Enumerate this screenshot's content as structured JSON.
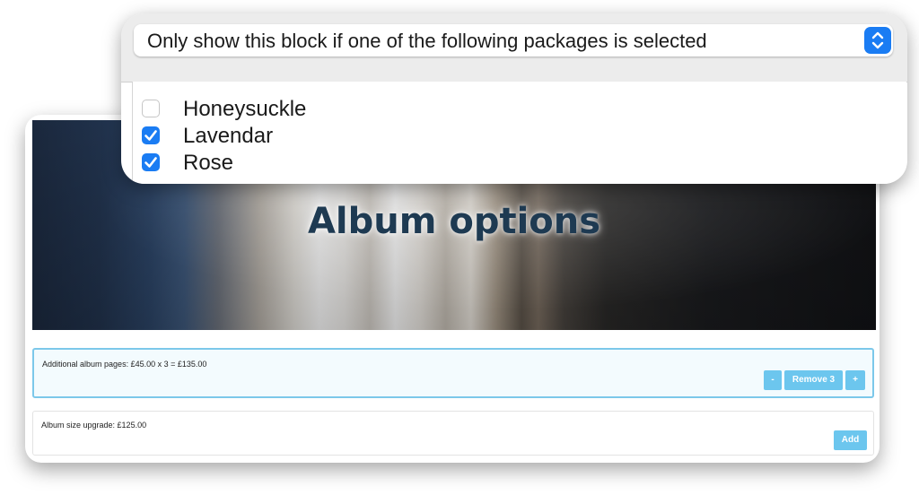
{
  "album_page": {
    "hero_title": "Album options",
    "options": [
      {
        "label": "Additional album pages: £45.00 x 3 = £135.00",
        "minus_label": "-",
        "remove_label": "Remove 3",
        "plus_label": "+"
      },
      {
        "label": "Album size upgrade: £125.00",
        "add_label": "Add"
      }
    ]
  },
  "condition_panel": {
    "select_value": "Only show this block if one of the following packages is selected",
    "packages": [
      {
        "label": "Honeysuckle",
        "checked": false
      },
      {
        "label": "Lavendar",
        "checked": true
      },
      {
        "label": "Rose",
        "checked": true
      }
    ]
  },
  "colors": {
    "accent_button": "#6cc6ee",
    "checkbox_blue": "#1a7cf3",
    "selected_row_border": "#7cc8ea"
  },
  "icons": {
    "select_arrow": "up-down-chevron-icon",
    "checkmark": "checkmark-icon"
  }
}
